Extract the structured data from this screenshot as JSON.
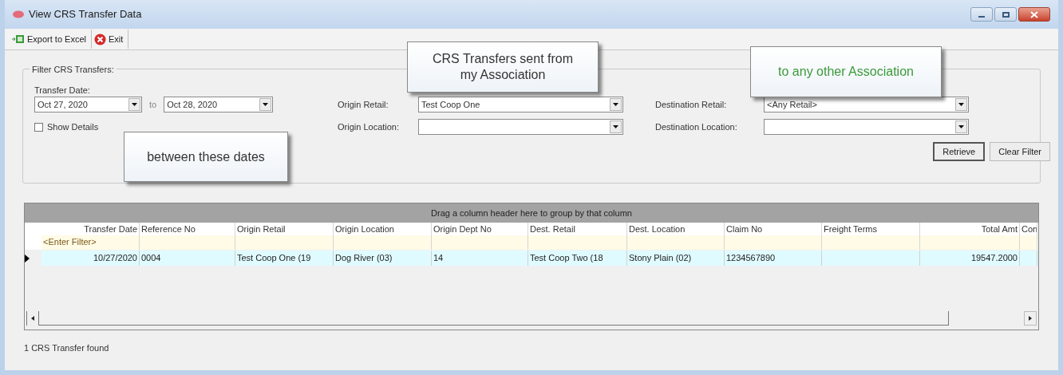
{
  "window": {
    "title": "View CRS Transfer Data"
  },
  "toolbar": [
    {
      "label": "Export to Excel",
      "kind": "excel"
    },
    {
      "label": "Exit",
      "kind": "exit"
    }
  ],
  "filter": {
    "title": "Filter CRS Transfers:",
    "date_label": "Transfer Date:",
    "date_from": "Oct 27, 2020",
    "to_label": "to",
    "date_to": "Oct 28, 2020",
    "show_details": {
      "label": "Show Details",
      "checked": false
    },
    "origin_retail": {
      "label": "Origin Retail:",
      "value": "Test Coop One"
    },
    "origin_location": {
      "label": "Origin Location:"
    },
    "destination_retail": {
      "label": "Destination Retail:",
      "value": "<Any Retail>"
    },
    "destination_location": {
      "label": "Destination Location:"
    },
    "buttons": [
      "Retrieve",
      "Clear Filter"
    ]
  },
  "callouts": [
    {
      "text": "CRS Transfers sent from my Association",
      "color": "#333333"
    },
    {
      "text": "between these dates",
      "color": "#333333"
    },
    {
      "text": "to any other Association",
      "color": "#3a9a3a"
    }
  ],
  "grid": {
    "group_panel": "Drag a column header here to group by that column",
    "columns": [
      {
        "label": "Transfer Date",
        "kind": "number",
        "filter": "<Enter Filter>"
      },
      {
        "label": "Reference No",
        "kind": "text"
      },
      {
        "label": "Origin Retail",
        "kind": "text"
      },
      {
        "label": "Origin Location",
        "kind": "text"
      },
      {
        "label": "Origin Dept No",
        "kind": "text"
      },
      {
        "label": "Dest. Retail",
        "kind": "text"
      },
      {
        "label": "Dest. Location",
        "kind": "text"
      },
      {
        "label": "Claim No",
        "kind": "text"
      },
      {
        "label": "Freight Terms",
        "kind": "text"
      },
      {
        "label": "Total Amt",
        "kind": "number"
      },
      {
        "label": "Con",
        "kind": "text"
      }
    ],
    "rows": [
      {
        "selected": true,
        "cells": [
          "10/27/2020",
          "0004",
          "Test Coop One (19",
          "Dog River (03)",
          "14",
          "Test Coop Two (18",
          "Stony Plain (02)",
          "1234567890",
          null,
          "19547.2000",
          null
        ]
      }
    ]
  },
  "status": "1 CRS Transfer found"
}
